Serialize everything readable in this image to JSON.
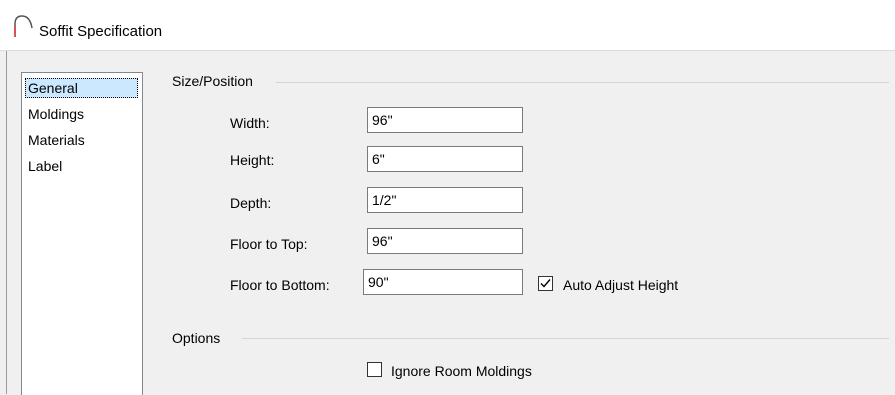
{
  "window": {
    "title": "Soffit Specification",
    "icon": "soffit-arc-icon"
  },
  "nav": {
    "items": [
      {
        "label": "General",
        "selected": true
      },
      {
        "label": "Moldings",
        "selected": false
      },
      {
        "label": "Materials",
        "selected": false
      },
      {
        "label": "Label",
        "selected": false
      }
    ]
  },
  "size_position": {
    "group_label": "Size/Position",
    "fields": [
      {
        "label": "Width:",
        "value": "96\""
      },
      {
        "label": "Height:",
        "value": "6\""
      },
      {
        "label": "Depth:",
        "value": "1/2\""
      },
      {
        "label": "Floor to Top:",
        "value": "96\""
      },
      {
        "label": "Floor to Bottom:",
        "value": "90\""
      }
    ],
    "auto_adjust": {
      "label": "Auto Adjust Height",
      "checked": true
    }
  },
  "options": {
    "group_label": "Options",
    "ignore_room_moldings": {
      "label": "Ignore Room Moldings",
      "checked": false
    }
  },
  "colors": {
    "selection": "#cce8ff",
    "icon_accent": "#d9534f"
  }
}
